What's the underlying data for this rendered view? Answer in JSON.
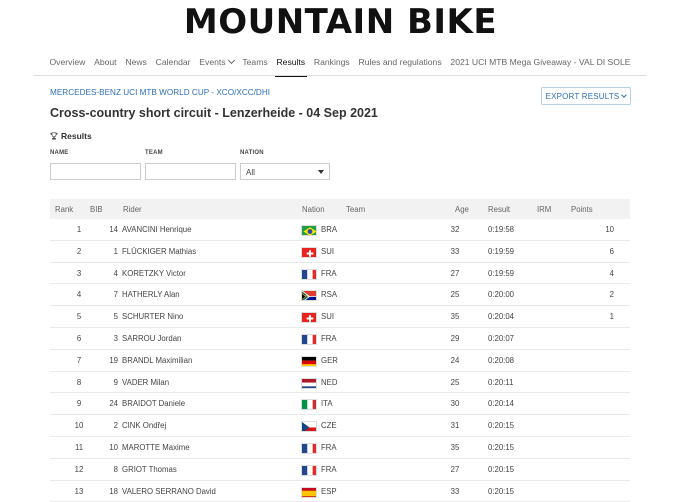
{
  "site": {
    "logo": "MOUNTAIN BIKE"
  },
  "nav": [
    {
      "label": "Overview"
    },
    {
      "label": "About"
    },
    {
      "label": "News"
    },
    {
      "label": "Calendar"
    },
    {
      "label": "Events"
    },
    {
      "label": "Teams"
    },
    {
      "label": "Results"
    },
    {
      "label": "Rankings"
    },
    {
      "label": "Rules and regulations"
    },
    {
      "label": "2021 UCI MTB Mega Giveaway - VAL DI SOLE"
    }
  ],
  "breadcrumb": "MERCEDES-BENZ UCI MTB WORLD CUP - XCO/XCC/DHI",
  "export_label": "EXPORT RESULTS",
  "page_title": "Cross-country short circuit - Lenzerheide - 04 Sep 2021",
  "section_title": "Results",
  "filters": {
    "name_label": "NAME",
    "team_label": "TEAM",
    "nation_label": "NATION",
    "nation_value": "All"
  },
  "table": {
    "headers": {
      "rank": "Rank",
      "bib": "BIB",
      "rider": "Rider",
      "nation": "Nation",
      "team": "Team",
      "age": "Age",
      "result": "Result",
      "irm": "IRM",
      "points": "Points"
    },
    "rows": [
      {
        "rank": "1",
        "bib": "14",
        "rider": "AVANCINI Henrique",
        "nation": "BRA",
        "age": "32",
        "result": "0:19:58",
        "points": "10"
      },
      {
        "rank": "2",
        "bib": "1",
        "rider": "FLÜCKIGER Mathias",
        "nation": "SUI",
        "age": "33",
        "result": "0:19:59",
        "points": "6"
      },
      {
        "rank": "3",
        "bib": "4",
        "rider": "KORETZKY Victor",
        "nation": "FRA",
        "age": "27",
        "result": "0:19:59",
        "points": "4"
      },
      {
        "rank": "4",
        "bib": "7",
        "rider": "HATHERLY Alan",
        "nation": "RSA",
        "age": "25",
        "result": "0:20:00",
        "points": "2"
      },
      {
        "rank": "5",
        "bib": "5",
        "rider": "SCHURTER Nino",
        "nation": "SUI",
        "age": "35",
        "result": "0:20:04",
        "points": "1"
      },
      {
        "rank": "6",
        "bib": "3",
        "rider": "SARROU Jordan",
        "nation": "FRA",
        "age": "29",
        "result": "0:20:07",
        "points": ""
      },
      {
        "rank": "7",
        "bib": "19",
        "rider": "BRANDL Maximilian",
        "nation": "GER",
        "age": "24",
        "result": "0:20:08",
        "points": ""
      },
      {
        "rank": "8",
        "bib": "9",
        "rider": "VADER Milan",
        "nation": "NED",
        "age": "25",
        "result": "0:20:11",
        "points": ""
      },
      {
        "rank": "9",
        "bib": "24",
        "rider": "BRAIDOT Daniele",
        "nation": "ITA",
        "age": "30",
        "result": "0:20:14",
        "points": ""
      },
      {
        "rank": "10",
        "bib": "2",
        "rider": "CINK Ondřej",
        "nation": "CZE",
        "age": "31",
        "result": "0:20:15",
        "points": ""
      },
      {
        "rank": "11",
        "bib": "10",
        "rider": "MAROTTE Maxime",
        "nation": "FRA",
        "age": "35",
        "result": "0:20:15",
        "points": ""
      },
      {
        "rank": "12",
        "bib": "8",
        "rider": "GRIOT Thomas",
        "nation": "FRA",
        "age": "27",
        "result": "0:20:15",
        "points": ""
      },
      {
        "rank": "13",
        "bib": "18",
        "rider": "VALERO SERRANO David",
        "nation": "ESP",
        "age": "33",
        "result": "0:20:15",
        "points": ""
      }
    ]
  },
  "colors": {
    "link": "#2f6fb6",
    "header_bg": "#f2f2f2"
  }
}
